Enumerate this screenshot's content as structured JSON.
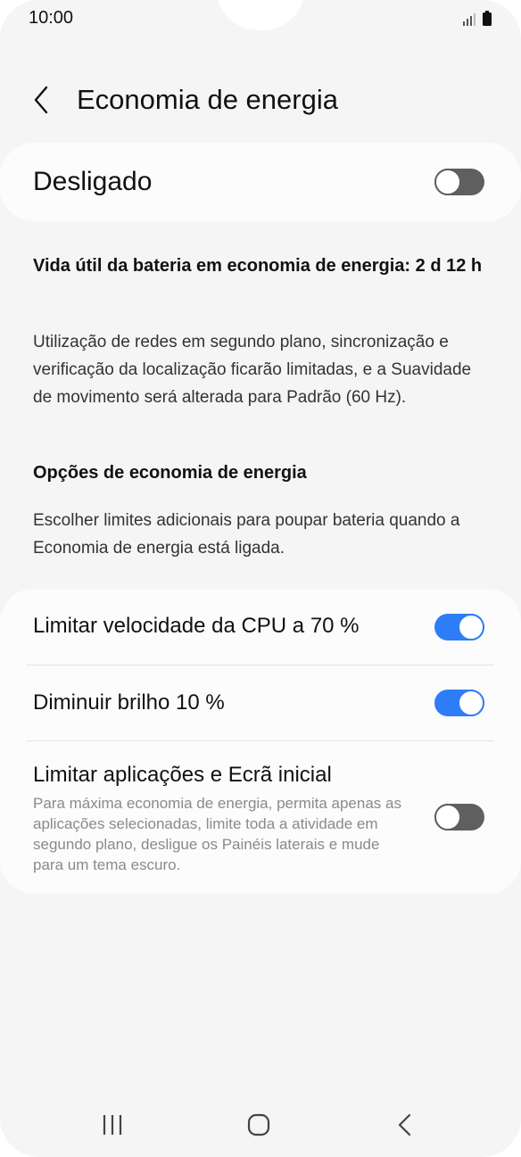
{
  "status_bar": {
    "time": "10:00",
    "icons": [
      "signal-icon",
      "battery-icon"
    ]
  },
  "header": {
    "back_icon": "chevron-left-icon",
    "title": "Economia de energia"
  },
  "master_switch": {
    "label": "Desligado",
    "state": "off"
  },
  "info": {
    "battery_life": "Vida útil da bateria em economia de energia: 2 d 12 h",
    "description": "Utilização de redes em segundo plano, sincronização e verificação da localização ficarão limitadas, e a Suavidade de movimento será alterada para Padrão (60 Hz).",
    "options_heading": "Opções de economia de energia",
    "options_description": "Escolher limites adicionais para poupar bateria quando a Economia de energia está ligada."
  },
  "options": [
    {
      "label": "Limitar velocidade da CPU a 70 %",
      "state": "on"
    },
    {
      "label": "Diminuir brilho 10 %",
      "state": "on"
    },
    {
      "label": "Limitar aplicações e Ecrã inicial",
      "sub": "Para máxima economia de energia, permita apenas as aplicações selecionadas, limite toda a atividade em segundo plano, desligue os Painéis laterais e mude para um tema escuro.",
      "state": "off"
    }
  ],
  "nav_bar": {
    "icons": [
      "recent-apps-icon",
      "home-icon",
      "back-icon"
    ]
  },
  "colors": {
    "toggle_on": "#2e7df6",
    "toggle_off": "#5f5f5f",
    "background": "#f5f5f5",
    "card": "#fcfcfc"
  }
}
